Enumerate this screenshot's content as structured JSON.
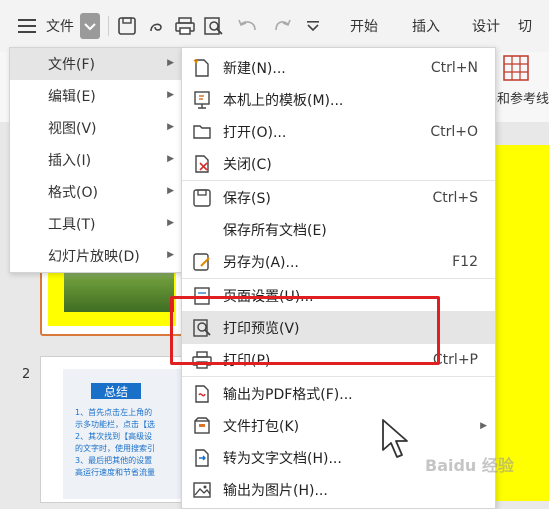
{
  "toolbar": {
    "file_label": "文件",
    "tabs": [
      "开始",
      "插入",
      "设计",
      "切"
    ]
  },
  "ribbon": {
    "partial_label": "格和参考线"
  },
  "slides": {
    "second_number": "2",
    "second_title": "总结",
    "second_text": "1、首先点击左上角的\n示多功能栏，点击【选\n2、其次找到【高级设\n的文字时，使用搜索引\n3、最后把其他的设置\n高运行速度和节省流量"
  },
  "left_menu": {
    "items": [
      {
        "label": "文件(F)",
        "has_arrow": true,
        "active": true
      },
      {
        "label": "编辑(E)",
        "has_arrow": true
      },
      {
        "label": "视图(V)",
        "has_arrow": true
      },
      {
        "label": "插入(I)",
        "has_arrow": true
      },
      {
        "label": "格式(O)",
        "has_arrow": true
      },
      {
        "label": "工具(T)",
        "has_arrow": true
      },
      {
        "label": "幻灯片放映(D)",
        "has_arrow": true
      }
    ]
  },
  "file_menu": {
    "items": [
      {
        "label": "新建(N)...",
        "shortcut": "Ctrl+N",
        "icon": "new-file-icon"
      },
      {
        "label": "本机上的模板(M)...",
        "shortcut": "",
        "icon": "template-icon"
      },
      {
        "label": "打开(O)...",
        "shortcut": "Ctrl+O",
        "icon": "open-folder-icon"
      },
      {
        "label": "关闭(C)",
        "shortcut": "",
        "icon": "close-doc-icon"
      },
      {
        "label": "保存(S)",
        "shortcut": "Ctrl+S",
        "icon": "save-icon"
      },
      {
        "label": "保存所有文档(E)",
        "shortcut": "",
        "icon": ""
      },
      {
        "label": "另存为(A)...",
        "shortcut": "F12",
        "icon": "save-as-icon"
      },
      {
        "label": "页面设置(U)...",
        "shortcut": "",
        "icon": "page-setup-icon"
      },
      {
        "label": "打印预览(V)",
        "shortcut": "",
        "icon": "print-preview-icon",
        "active": true
      },
      {
        "label": "打印(P)...",
        "shortcut": "Ctrl+P",
        "icon": "printer-icon"
      },
      {
        "label": "输出为PDF格式(F)...",
        "shortcut": "",
        "icon": "pdf-icon"
      },
      {
        "label": "文件打包(K)",
        "shortcut": "",
        "icon": "package-icon",
        "has_arrow": true
      },
      {
        "label": "转为文字文档(H)...",
        "shortcut": "",
        "icon": "convert-doc-icon"
      },
      {
        "label": "输出为图片(H)...",
        "shortcut": "",
        "icon": "export-image-icon"
      }
    ]
  },
  "colors": {
    "highlight": "#e02020",
    "slide_bg": "#ffff00",
    "accent": "#1a70c8"
  },
  "watermark": "Baidu 经验"
}
